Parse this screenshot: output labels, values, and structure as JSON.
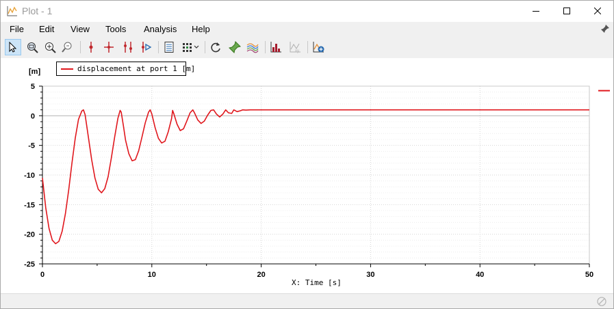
{
  "window": {
    "title": "Plot - 1"
  },
  "menu": [
    "File",
    "Edit",
    "View",
    "Tools",
    "Analysis",
    "Help"
  ],
  "toolbar": {
    "buttons": [
      {
        "name": "select-arrow-icon",
        "active": true
      },
      {
        "name": "zoom-region-icon"
      },
      {
        "name": "zoom-in-icon"
      },
      {
        "name": "zoom-out-icon"
      },
      {
        "name": "marker-add-icon"
      },
      {
        "name": "crosshair-icon"
      },
      {
        "name": "multi-marker-icon"
      },
      {
        "name": "marker-play-icon"
      },
      {
        "name": "data-table-icon"
      },
      {
        "name": "grid-layout-icon"
      },
      {
        "name": "refresh-icon"
      },
      {
        "name": "pin-green-icon"
      },
      {
        "name": "curves-color-icon"
      },
      {
        "name": "histogram-icon"
      },
      {
        "name": "xy-disabled-icon"
      },
      {
        "name": "add-plot-icon"
      }
    ]
  },
  "legend": {
    "label": "displacement at port 1 [m]",
    "color": "#e0161c"
  },
  "axes": {
    "y_unit": "[m]",
    "x_label": "X: Time [s]"
  },
  "chart_data": {
    "type": "line",
    "series": [
      {
        "name": "displacement at port 1 [m]",
        "color": "#e0161c",
        "x": [
          0,
          0.3,
          0.6,
          0.9,
          1.2,
          1.5,
          1.8,
          2.1,
          2.4,
          2.7,
          3.0,
          3.3,
          3.6,
          3.75,
          3.9,
          4.2,
          4.5,
          4.8,
          5.1,
          5.4,
          5.7,
          6.0,
          6.3,
          6.6,
          6.9,
          7.1,
          7.2,
          7.4,
          7.6,
          7.9,
          8.2,
          8.5,
          8.8,
          9.1,
          9.4,
          9.7,
          9.85,
          10.0,
          10.3,
          10.6,
          10.9,
          11.2,
          11.5,
          11.8,
          11.9,
          12.0,
          12.3,
          12.6,
          12.9,
          13.2,
          13.5,
          13.75,
          13.9,
          14.2,
          14.5,
          14.8,
          15.1,
          15.4,
          15.65,
          15.9,
          16.2,
          16.5,
          16.75,
          17.0,
          17.3,
          17.5,
          17.8,
          18.1,
          18.3,
          18.6,
          19.0,
          20,
          30,
          40,
          50
        ],
        "y": [
          -10.5,
          -15.5,
          -19.0,
          -21.0,
          -21.6,
          -21.2,
          -19.5,
          -16.5,
          -12.5,
          -8.0,
          -3.8,
          -0.6,
          0.8,
          1.0,
          0.2,
          -3.6,
          -7.4,
          -10.5,
          -12.4,
          -13.0,
          -12.3,
          -10.3,
          -7.1,
          -3.6,
          -0.4,
          0.9,
          0.6,
          -1.7,
          -4.1,
          -6.4,
          -7.6,
          -7.4,
          -5.9,
          -3.6,
          -1.2,
          0.6,
          1.0,
          0.3,
          -2.0,
          -3.8,
          -4.6,
          -4.3,
          -2.7,
          -0.5,
          0.9,
          0.4,
          -1.4,
          -2.5,
          -2.2,
          -0.9,
          0.5,
          1.0,
          0.5,
          -0.7,
          -1.3,
          -0.9,
          0.1,
          0.9,
          1.0,
          0.3,
          -0.2,
          0.3,
          1.0,
          0.5,
          0.4,
          1.0,
          0.7,
          0.85,
          1.0,
          0.95,
          1.0,
          1.0,
          1.0,
          1.0,
          1.0
        ]
      }
    ],
    "xlim": [
      0,
      50
    ],
    "ylim": [
      -25,
      5
    ],
    "x_ticks": [
      "0",
      "10",
      "20",
      "30",
      "40",
      "50"
    ],
    "y_ticks": [
      "5",
      "0",
      "-5",
      "-10",
      "-15",
      "-20",
      "-25"
    ],
    "grid": true,
    "legend_position": "top-left"
  }
}
